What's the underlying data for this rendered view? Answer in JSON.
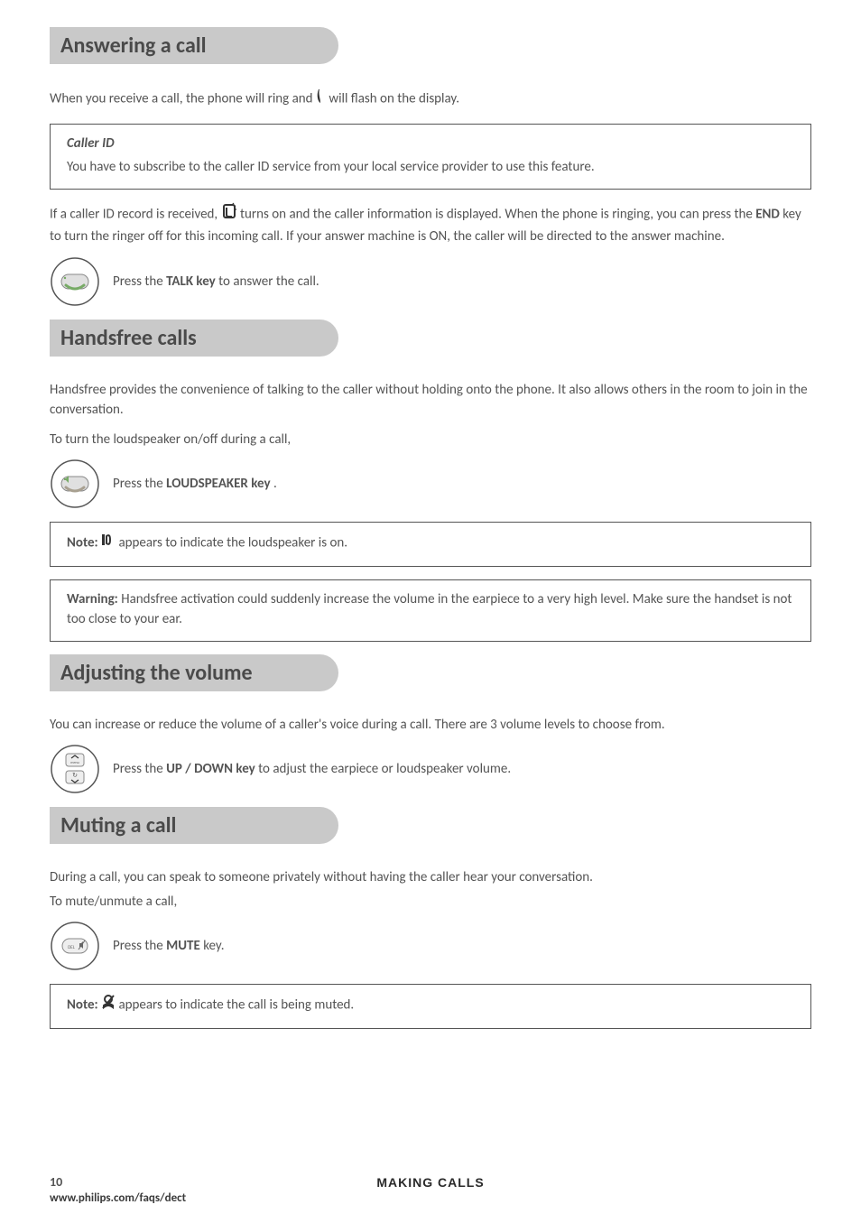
{
  "sections": {
    "answering": {
      "title": "Answering a call",
      "intro_pre": "When you receive a call, the phone will ring and ",
      "intro_post": " will flash on the display.",
      "callerid_title": "Caller ID",
      "callerid_text": "You have to subscribe to the caller ID service from your local service provider to use this feature.",
      "record_pre": "If a caller ID record is received, ",
      "record_mid": " turns on and the caller information is displayed.  When the phone is ringing, you can press the ",
      "record_bold": "END",
      "record_post": " key to turn the ringer off for this incoming call.  If your answer machine is ON, the caller will be directed to the answer machine.",
      "step_pre": "Press the ",
      "step_bold": "TALK key",
      "step_post": " to answer the call."
    },
    "handsfree": {
      "title": "Handsfree calls",
      "intro": "Handsfree provides the convenience of talking to the caller without holding onto the phone.  It also allows others in the room to join in the conversation.",
      "toturn": "To turn the loudspeaker on/off during a call,",
      "step_pre": "Press the ",
      "step_bold": "LOUDSPEAKER key",
      "step_post": ".",
      "note_pre": "Note: ",
      "note_post": " appears to indicate the loudspeaker is on.",
      "warning_label": "Warning:",
      "warning_text": " Handsfree activation could suddenly increase the volume in the earpiece to a very high level. Make sure the handset is not too close to your ear."
    },
    "volume": {
      "title": "Adjusting the volume",
      "intro": "You can increase or reduce the volume of a caller's voice during a call.  There are 3 volume levels to choose from.",
      "step_pre": "Press the ",
      "step_bold": "UP / DOWN key",
      "step_post": " to adjust the earpiece or loudspeaker volume."
    },
    "muting": {
      "title": "Muting a call",
      "intro": "During a call, you can speak to someone privately without having the caller hear your conversation.",
      "tomute": "To mute/unmute a call,",
      "step_pre": "Press the ",
      "step_bold": "MUTE",
      "step_post": " key.",
      "note_pre": "Note: ",
      "note_post": " appears to indicate the call is being muted."
    }
  },
  "footer": {
    "page": "10",
    "center": "MAKING CALLS",
    "url": "www.philips.com/faqs/dect"
  }
}
